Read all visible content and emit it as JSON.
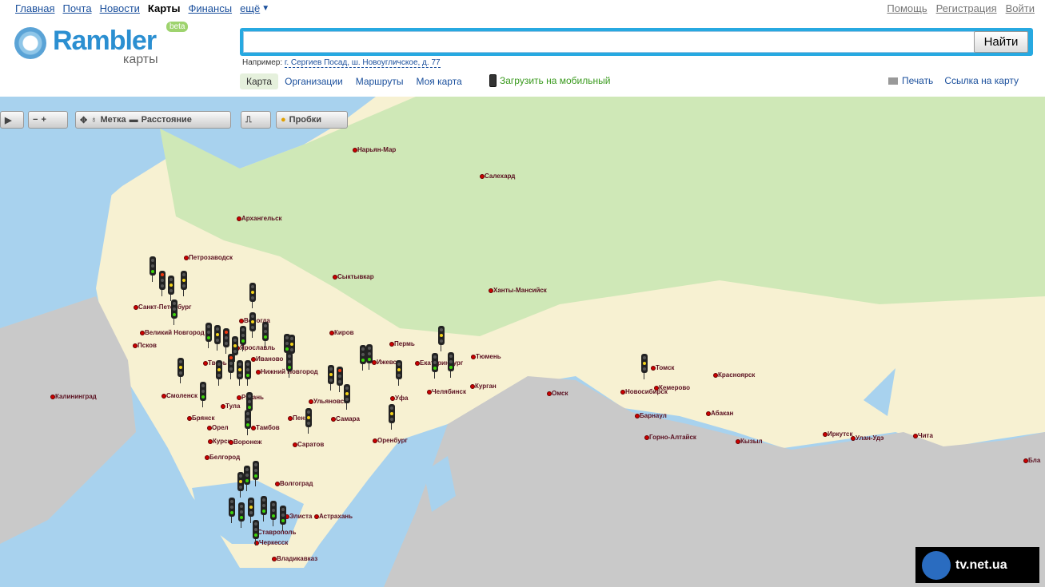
{
  "nav": {
    "items": [
      "Главная",
      "Почта",
      "Новости",
      "Карты",
      "Финансы",
      "ещё"
    ],
    "active": "Карты"
  },
  "right_nav": [
    "Помощь",
    "Регистрация",
    "Войти"
  ],
  "logo": {
    "word": "Rambler",
    "sub": "карты",
    "badge": "beta"
  },
  "search": {
    "value": "",
    "button": "Найти"
  },
  "example": {
    "prefix": "Например:",
    "text": "г. Сергиев Посад, ш. Новоугличское, д. 77"
  },
  "tabs": [
    "Карта",
    "Организации",
    "Маршруты",
    "Моя карта"
  ],
  "mobile": "Загрузить на мобильный",
  "tools": {
    "print": "Печать",
    "link": "Ссылка на карту"
  },
  "map_toolbar": {
    "mark": "Метка",
    "distance": "Расстояние",
    "traffic": "Пробки"
  },
  "cities": [
    {
      "name": "Нарьян-Мар"
    },
    {
      "name": "Салехард"
    },
    {
      "name": "Архангельск"
    },
    {
      "name": "Петрозаводск"
    },
    {
      "name": "Сыктывкар"
    },
    {
      "name": "Ханты-Мансийск"
    },
    {
      "name": "Санкт-Петербург"
    },
    {
      "name": "Великий Новгород"
    },
    {
      "name": "Псков"
    },
    {
      "name": "Вологда"
    },
    {
      "name": "Киров"
    },
    {
      "name": "Пермь"
    },
    {
      "name": "Ярославль"
    },
    {
      "name": "Иваново"
    },
    {
      "name": "Ижевск"
    },
    {
      "name": "Екатеринбург"
    },
    {
      "name": "Тюмень"
    },
    {
      "name": "Нижний Новгород"
    },
    {
      "name": "Тверь"
    },
    {
      "name": "Калининград"
    },
    {
      "name": "Смоленск"
    },
    {
      "name": "Челябинск"
    },
    {
      "name": "Курган"
    },
    {
      "name": "Омск"
    },
    {
      "name": "Новосибирск"
    },
    {
      "name": "Томск"
    },
    {
      "name": "Кемерово"
    },
    {
      "name": "Красноярск"
    },
    {
      "name": "Уфа"
    },
    {
      "name": "Ульяновск"
    },
    {
      "name": "Тула"
    },
    {
      "name": "Рязань"
    },
    {
      "name": "Брянск"
    },
    {
      "name": "Орел"
    },
    {
      "name": "Тамбов"
    },
    {
      "name": "Пенза"
    },
    {
      "name": "Самара"
    },
    {
      "name": "Оренбург"
    },
    {
      "name": "Барнаул"
    },
    {
      "name": "Абакан"
    },
    {
      "name": "Курск"
    },
    {
      "name": "Воронеж"
    },
    {
      "name": "Саратов"
    },
    {
      "name": "Горно-Алтайск"
    },
    {
      "name": "Кызыл"
    },
    {
      "name": "Иркутск"
    },
    {
      "name": "Улан-Удэ"
    },
    {
      "name": "Чита"
    },
    {
      "name": "Белгород"
    },
    {
      "name": "Волгоград"
    },
    {
      "name": "Элиста"
    },
    {
      "name": "Астрахань"
    },
    {
      "name": "Ставрополь"
    },
    {
      "name": "Черкесск"
    },
    {
      "name": "Владикавказ"
    },
    {
      "name": "Бла"
    }
  ],
  "watermark": "tv.net.ua"
}
